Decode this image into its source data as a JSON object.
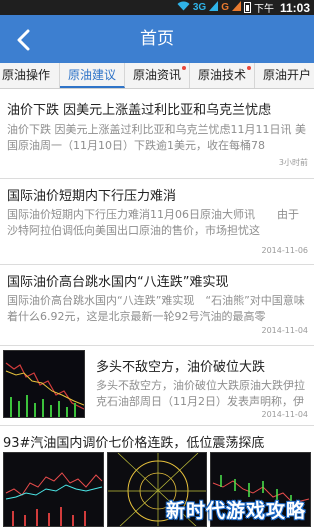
{
  "status_bar": {
    "network_1": "3G",
    "network_2": "G",
    "period": "下午",
    "time": "11:03"
  },
  "header": {
    "title": "首页",
    "back_icon": "chevron-left-icon"
  },
  "tabs": [
    {
      "label": "原油操作",
      "active": false,
      "badge": false
    },
    {
      "label": "原油建议",
      "active": true,
      "badge": false
    },
    {
      "label": "原油资讯",
      "active": false,
      "badge": true
    },
    {
      "label": "原油技术",
      "active": false,
      "badge": true
    },
    {
      "label": "原油开户",
      "active": false,
      "badge": false
    }
  ],
  "news": [
    {
      "title": "油价下跌 因美元上涨盖过利比亚和乌克兰忧虑",
      "summary": "油价下跌 因美元上涨盖过利比亚和乌克兰忧虑11月11日讯 美国原油周一（11月10日）下跌逾1美元，收在每桶78",
      "time": "3小时前"
    },
    {
      "title": "国际油价短期内下行压力难消",
      "summary": "国际油价短期内下行压力难消11月06日原油大师讯　　由于沙特阿拉伯调低向美国出口原油的售价，市场担忧这",
      "time": "2014-11-06"
    },
    {
      "title": "国际油价高台跳水国内“八连跌”难实现",
      "summary": "国际油价高台跳水国内“八连跌”难实现　“石油熊”对中国意味着什么6.92元，这是北京最新一轮92号汽油的最高零",
      "time": "2014-11-04"
    },
    {
      "title": "多头不敌空方，油价破位大跌",
      "summary": "多头不敌空方，油价破位大跌原油大跌伊拉克石油部周日（11月2日）发表声明称，伊",
      "time": "2014-11-04"
    },
    {
      "title": "93#汽油国内调价七价格连跌，低位震荡探底"
    }
  ],
  "watermark": "新时代游戏攻略",
  "colors": {
    "header_blue": "#3d7fd0",
    "tab_active": "#2f74c8",
    "badge_red": "#e8473c"
  }
}
